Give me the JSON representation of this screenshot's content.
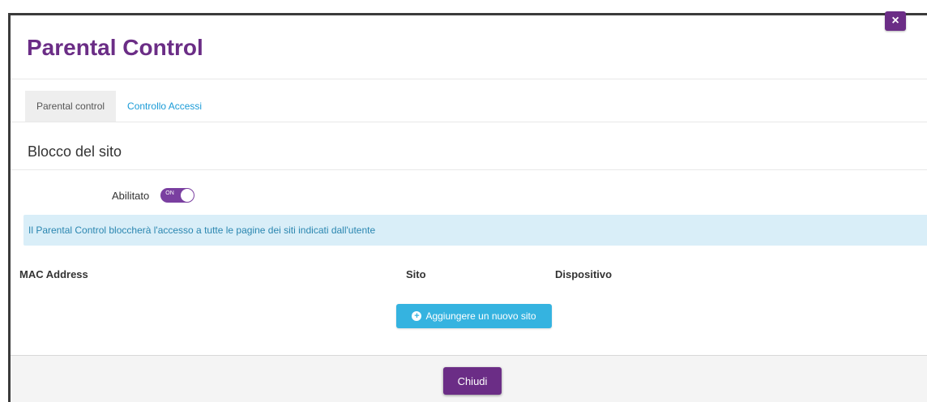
{
  "modal": {
    "title": "Parental Control",
    "close_icon_glyph": "×"
  },
  "tabs": [
    {
      "label": "Parental control",
      "active": true
    },
    {
      "label": "Controllo Accessi",
      "active": false
    }
  ],
  "section": {
    "title": "Blocco del sito",
    "toggle_label": "Abilitato",
    "toggle_text": "ON",
    "toggle_state": true
  },
  "alert": {
    "text": "Il Parental Control bloccherà l'accesso a tutte le pagine dei siti indicati dall'utente"
  },
  "table": {
    "columns": [
      "MAC Address",
      "Sito",
      "Dispositivo"
    ]
  },
  "add_button": {
    "icon": "plus-circle-icon",
    "label": "Aggiungere un nuovo sito"
  },
  "footer": {
    "close_label": "Chiudi"
  },
  "colors": {
    "brand": "#6b2d86",
    "link": "#1a9bd7",
    "info_bg": "#d9eef8",
    "button_blue": "#35b3e0"
  }
}
